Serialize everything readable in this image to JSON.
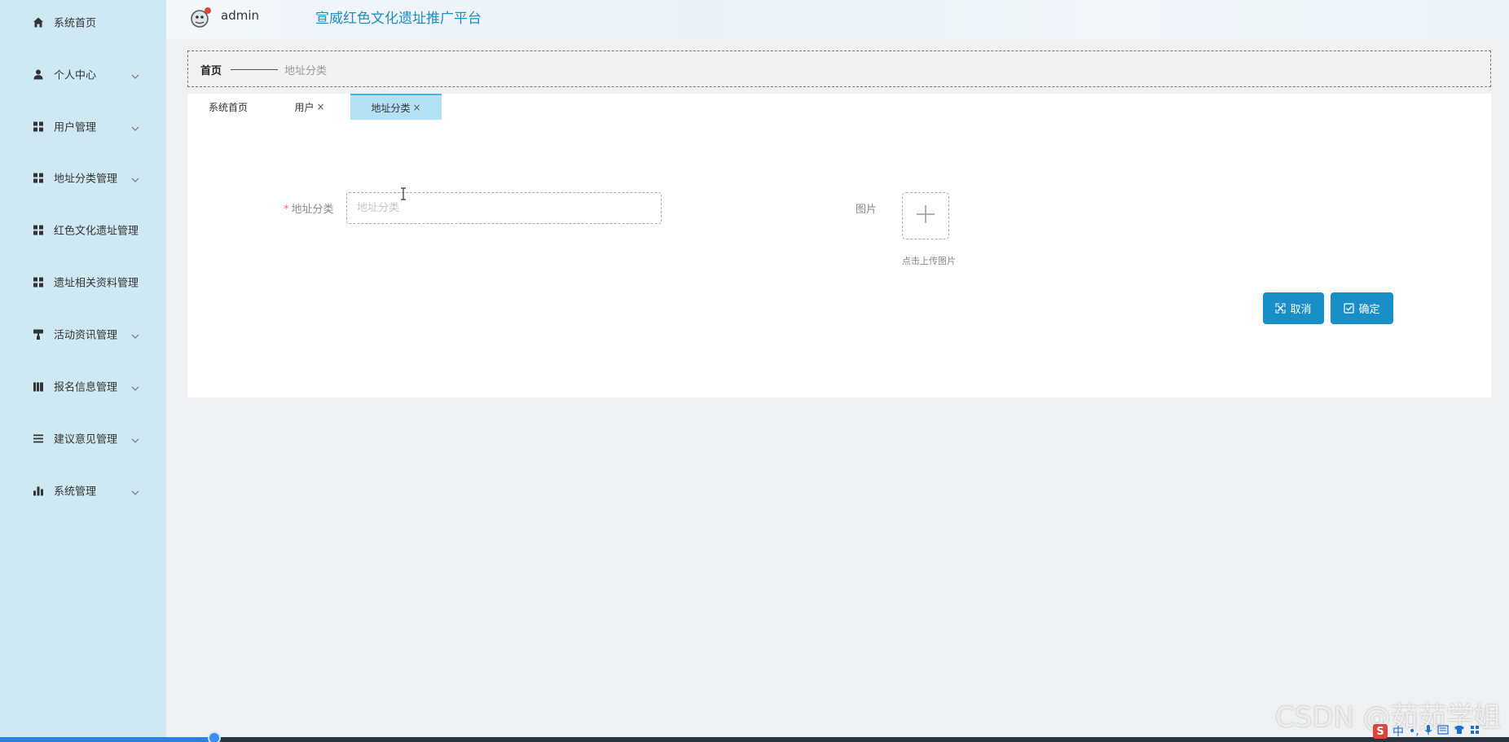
{
  "sidebar": {
    "items": [
      {
        "label": "系统首页",
        "icon": "home-icon",
        "expandable": false
      },
      {
        "label": "个人中心",
        "icon": "user-icon",
        "expandable": true
      },
      {
        "label": "用户管理",
        "icon": "grid-icon",
        "expandable": true
      },
      {
        "label": "地址分类管理",
        "icon": "grid-icon",
        "expandable": true
      },
      {
        "label": "红色文化遗址管理",
        "icon": "grid-icon",
        "expandable": false
      },
      {
        "label": "遗址相关资料管理",
        "icon": "grid-icon",
        "expandable": false
      },
      {
        "label": "活动资讯管理",
        "icon": "paint-roller-icon",
        "expandable": true
      },
      {
        "label": "报名信息管理",
        "icon": "book-icon",
        "expandable": true
      },
      {
        "label": "建议意见管理",
        "icon": "list-icon",
        "expandable": true
      },
      {
        "label": "系统管理",
        "icon": "bar-chart-icon",
        "expandable": true
      }
    ]
  },
  "header": {
    "username": "admin",
    "title": "宣威红色文化遗址推广平台"
  },
  "breadcrumb": {
    "home": "首页",
    "current": "地址分类"
  },
  "tabs": [
    {
      "label": "系统首页",
      "closable": false,
      "active": false
    },
    {
      "label": "用户",
      "closable": true,
      "active": false
    },
    {
      "label": "地址分类",
      "closable": true,
      "active": true
    }
  ],
  "form": {
    "category_label": "地址分类",
    "category_required_mark": "*",
    "category_value": "",
    "category_placeholder": "地址分类",
    "image_label": "图片",
    "upload_hint": "点击上传图片"
  },
  "buttons": {
    "cancel": "取消",
    "confirm": "确定"
  },
  "overlay": {
    "watermark": "CSDN @茹茹学姐",
    "ime_mode": "中"
  },
  "colors": {
    "sidebar_bg": "#cfe9f4",
    "accent": "#1a8fc7",
    "title": "#1a8ec7",
    "active_tab": "#b4e1f6",
    "required": "#f56c6c"
  }
}
